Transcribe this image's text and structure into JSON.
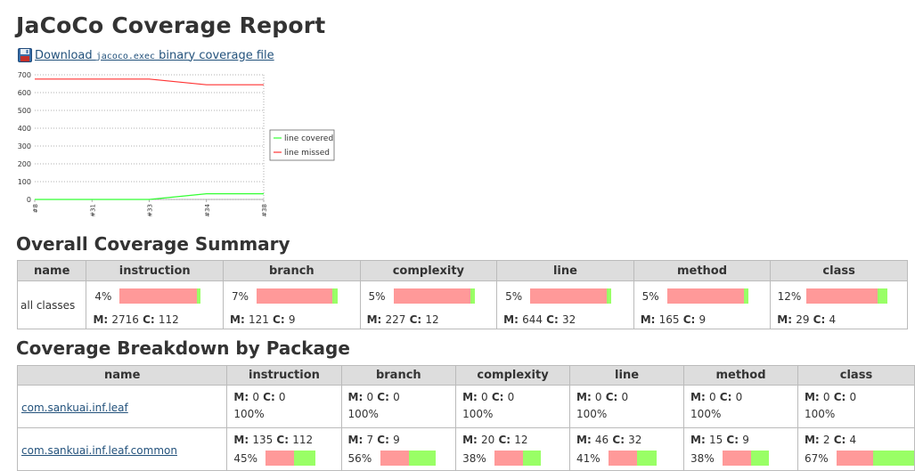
{
  "title": "JaCoCo Coverage Report",
  "download": {
    "prefix": "Download ",
    "file": "jacoco.exec",
    "suffix": " binary coverage file",
    "icon": "floppy-disk-icon"
  },
  "colors": {
    "missed": "#ff9999",
    "covered": "#99ff66",
    "header_bg": "#dddddd",
    "link": "#23527c"
  },
  "chart_data": {
    "type": "line",
    "x": [
      "#8",
      "#31",
      "#33",
      "#34",
      "#38"
    ],
    "ylim": [
      0,
      700
    ],
    "yticks": [
      "0",
      "100",
      "200",
      "300",
      "400",
      "500",
      "600",
      "700"
    ],
    "grid": true,
    "legend_position": "right",
    "series": [
      {
        "name": "line covered",
        "color": "#33ff33",
        "values": [
          0,
          0,
          0,
          32,
          32
        ]
      },
      {
        "name": "line missed",
        "color": "#ff3333",
        "values": [
          676,
          676,
          676,
          644,
          644
        ]
      }
    ]
  },
  "summary": {
    "heading": "Overall Coverage Summary",
    "columns": [
      "name",
      "instruction",
      "branch",
      "complexity",
      "line",
      "method",
      "class"
    ],
    "row_name": "all classes",
    "cells": [
      {
        "pct": "4%",
        "m": "2716",
        "c": "112",
        "covered": 0.04
      },
      {
        "pct": "7%",
        "m": "121",
        "c": "9",
        "covered": 0.07
      },
      {
        "pct": "5%",
        "m": "227",
        "c": "12",
        "covered": 0.05
      },
      {
        "pct": "5%",
        "m": "644",
        "c": "32",
        "covered": 0.05
      },
      {
        "pct": "5%",
        "m": "165",
        "c": "9",
        "covered": 0.05
      },
      {
        "pct": "12%",
        "m": "29",
        "c": "4",
        "covered": 0.12
      }
    ]
  },
  "breakdown": {
    "heading": "Coverage Breakdown by Package",
    "columns": [
      "name",
      "instruction",
      "branch",
      "complexity",
      "line",
      "method",
      "class"
    ],
    "rows": [
      {
        "name": "com.sankuai.inf.leaf",
        "cells": [
          {
            "m": "0",
            "c": "0",
            "pct": "100%"
          },
          {
            "m": "0",
            "c": "0",
            "pct": "100%"
          },
          {
            "m": "0",
            "c": "0",
            "pct": "100%"
          },
          {
            "m": "0",
            "c": "0",
            "pct": "100%"
          },
          {
            "m": "0",
            "c": "0",
            "pct": "100%"
          },
          {
            "m": "0",
            "c": "0",
            "pct": "100%"
          }
        ]
      },
      {
        "name": "com.sankuai.inf.leaf.common",
        "cells": [
          {
            "m": "135",
            "c": "112",
            "pct": "45%",
            "covered": 0.45
          },
          {
            "m": "7",
            "c": "9",
            "pct": "56%",
            "covered": 0.56
          },
          {
            "m": "20",
            "c": "12",
            "pct": "38%",
            "covered": 0.38
          },
          {
            "m": "46",
            "c": "32",
            "pct": "41%",
            "covered": 0.41
          },
          {
            "m": "15",
            "c": "9",
            "pct": "38%",
            "covered": 0.38
          },
          {
            "m": "2",
            "c": "4",
            "pct": "67%",
            "covered": 0.67
          }
        ]
      }
    ]
  }
}
